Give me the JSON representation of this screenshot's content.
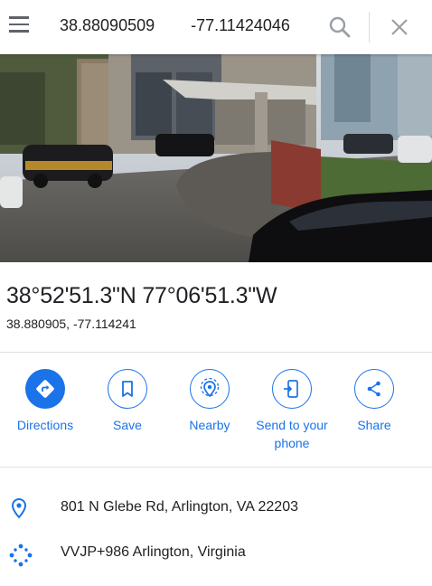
{
  "search": {
    "query": "38.88090509        -77.11424046"
  },
  "place": {
    "coords_dms": "38°52'51.3\"N 77°06'51.3\"W",
    "coords_decimal": "38.880905, -77.114241"
  },
  "actions": [
    {
      "label": "Directions",
      "icon": "directions-icon"
    },
    {
      "label": "Save",
      "icon": "bookmark-icon"
    },
    {
      "label": "Nearby",
      "icon": "nearby-icon"
    },
    {
      "label": "Send to your phone",
      "icon": "send-to-phone-icon"
    },
    {
      "label": "Share",
      "icon": "share-icon"
    }
  ],
  "details": {
    "address": "801 N Glebe Rd, Arlington, VA 22203",
    "plus_code": "VVJP+986 Arlington, Virginia"
  },
  "colors": {
    "accent": "#1a73e8",
    "text": "#202124",
    "icon_gray": "#5f6368"
  }
}
